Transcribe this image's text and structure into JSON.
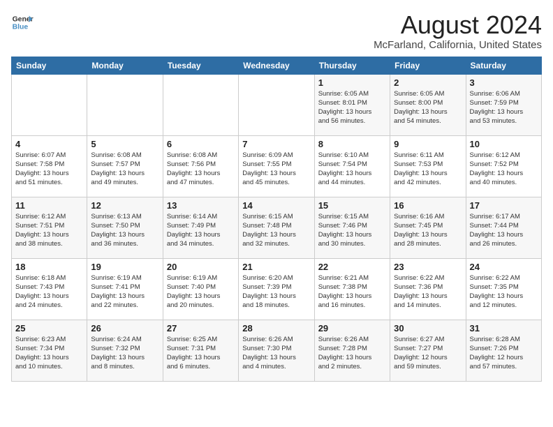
{
  "header": {
    "logo_line1": "General",
    "logo_line2": "Blue",
    "month_year": "August 2024",
    "location": "McFarland, California, United States"
  },
  "days_of_week": [
    "Sunday",
    "Monday",
    "Tuesday",
    "Wednesday",
    "Thursday",
    "Friday",
    "Saturday"
  ],
  "weeks": [
    [
      {
        "day": "",
        "content": ""
      },
      {
        "day": "",
        "content": ""
      },
      {
        "day": "",
        "content": ""
      },
      {
        "day": "",
        "content": ""
      },
      {
        "day": "1",
        "content": "Sunrise: 6:05 AM\nSunset: 8:01 PM\nDaylight: 13 hours\nand 56 minutes."
      },
      {
        "day": "2",
        "content": "Sunrise: 6:05 AM\nSunset: 8:00 PM\nDaylight: 13 hours\nand 54 minutes."
      },
      {
        "day": "3",
        "content": "Sunrise: 6:06 AM\nSunset: 7:59 PM\nDaylight: 13 hours\nand 53 minutes."
      }
    ],
    [
      {
        "day": "4",
        "content": "Sunrise: 6:07 AM\nSunset: 7:58 PM\nDaylight: 13 hours\nand 51 minutes."
      },
      {
        "day": "5",
        "content": "Sunrise: 6:08 AM\nSunset: 7:57 PM\nDaylight: 13 hours\nand 49 minutes."
      },
      {
        "day": "6",
        "content": "Sunrise: 6:08 AM\nSunset: 7:56 PM\nDaylight: 13 hours\nand 47 minutes."
      },
      {
        "day": "7",
        "content": "Sunrise: 6:09 AM\nSunset: 7:55 PM\nDaylight: 13 hours\nand 45 minutes."
      },
      {
        "day": "8",
        "content": "Sunrise: 6:10 AM\nSunset: 7:54 PM\nDaylight: 13 hours\nand 44 minutes."
      },
      {
        "day": "9",
        "content": "Sunrise: 6:11 AM\nSunset: 7:53 PM\nDaylight: 13 hours\nand 42 minutes."
      },
      {
        "day": "10",
        "content": "Sunrise: 6:12 AM\nSunset: 7:52 PM\nDaylight: 13 hours\nand 40 minutes."
      }
    ],
    [
      {
        "day": "11",
        "content": "Sunrise: 6:12 AM\nSunset: 7:51 PM\nDaylight: 13 hours\nand 38 minutes."
      },
      {
        "day": "12",
        "content": "Sunrise: 6:13 AM\nSunset: 7:50 PM\nDaylight: 13 hours\nand 36 minutes."
      },
      {
        "day": "13",
        "content": "Sunrise: 6:14 AM\nSunset: 7:49 PM\nDaylight: 13 hours\nand 34 minutes."
      },
      {
        "day": "14",
        "content": "Sunrise: 6:15 AM\nSunset: 7:48 PM\nDaylight: 13 hours\nand 32 minutes."
      },
      {
        "day": "15",
        "content": "Sunrise: 6:15 AM\nSunset: 7:46 PM\nDaylight: 13 hours\nand 30 minutes."
      },
      {
        "day": "16",
        "content": "Sunrise: 6:16 AM\nSunset: 7:45 PM\nDaylight: 13 hours\nand 28 minutes."
      },
      {
        "day": "17",
        "content": "Sunrise: 6:17 AM\nSunset: 7:44 PM\nDaylight: 13 hours\nand 26 minutes."
      }
    ],
    [
      {
        "day": "18",
        "content": "Sunrise: 6:18 AM\nSunset: 7:43 PM\nDaylight: 13 hours\nand 24 minutes."
      },
      {
        "day": "19",
        "content": "Sunrise: 6:19 AM\nSunset: 7:41 PM\nDaylight: 13 hours\nand 22 minutes."
      },
      {
        "day": "20",
        "content": "Sunrise: 6:19 AM\nSunset: 7:40 PM\nDaylight: 13 hours\nand 20 minutes."
      },
      {
        "day": "21",
        "content": "Sunrise: 6:20 AM\nSunset: 7:39 PM\nDaylight: 13 hours\nand 18 minutes."
      },
      {
        "day": "22",
        "content": "Sunrise: 6:21 AM\nSunset: 7:38 PM\nDaylight: 13 hours\nand 16 minutes."
      },
      {
        "day": "23",
        "content": "Sunrise: 6:22 AM\nSunset: 7:36 PM\nDaylight: 13 hours\nand 14 minutes."
      },
      {
        "day": "24",
        "content": "Sunrise: 6:22 AM\nSunset: 7:35 PM\nDaylight: 13 hours\nand 12 minutes."
      }
    ],
    [
      {
        "day": "25",
        "content": "Sunrise: 6:23 AM\nSunset: 7:34 PM\nDaylight: 13 hours\nand 10 minutes."
      },
      {
        "day": "26",
        "content": "Sunrise: 6:24 AM\nSunset: 7:32 PM\nDaylight: 13 hours\nand 8 minutes."
      },
      {
        "day": "27",
        "content": "Sunrise: 6:25 AM\nSunset: 7:31 PM\nDaylight: 13 hours\nand 6 minutes."
      },
      {
        "day": "28",
        "content": "Sunrise: 6:26 AM\nSunset: 7:30 PM\nDaylight: 13 hours\nand 4 minutes."
      },
      {
        "day": "29",
        "content": "Sunrise: 6:26 AM\nSunset: 7:28 PM\nDaylight: 13 hours\nand 2 minutes."
      },
      {
        "day": "30",
        "content": "Sunrise: 6:27 AM\nSunset: 7:27 PM\nDaylight: 12 hours\nand 59 minutes."
      },
      {
        "day": "31",
        "content": "Sunrise: 6:28 AM\nSunset: 7:26 PM\nDaylight: 12 hours\nand 57 minutes."
      }
    ]
  ]
}
